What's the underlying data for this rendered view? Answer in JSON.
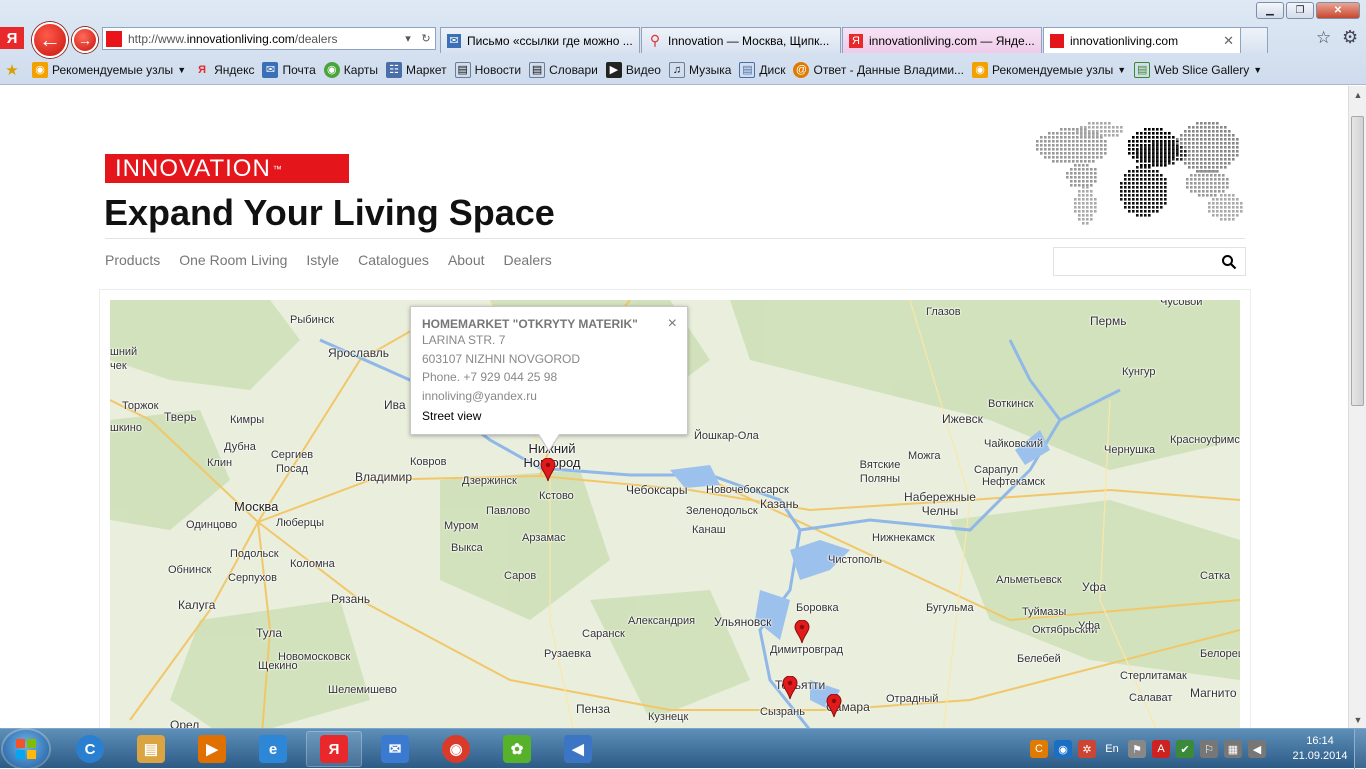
{
  "browser": {
    "window_controls": {
      "minimize": "▁",
      "maximize": "❐",
      "close": "✕"
    },
    "yandex_logo": "Я",
    "address": {
      "prefix": "http://www.",
      "host": "innovationliving.com",
      "path": "/dealers"
    },
    "tabs": [
      {
        "icon": "mail-icon",
        "label": "Письмо «ссылки где можно ...",
        "style": "normal"
      },
      {
        "icon": "map-pin-icon",
        "label": "Innovation — Москва, Щипк...",
        "style": "normal"
      },
      {
        "icon": "yandex-icon",
        "label": "innovationliving.com — Янде...",
        "style": "pink"
      },
      {
        "icon": "innovation-favicon",
        "label": "innovationliving.com",
        "style": "active"
      }
    ],
    "bookmarks": [
      {
        "icon": "folder-star-icon",
        "label": "Рекомендуемые узлы",
        "dropdown": true,
        "color": "#f2a100"
      },
      {
        "icon": "yandex-icon",
        "label": "Яндекс",
        "dropdown": false,
        "color": "#e8282b"
      },
      {
        "icon": "mail-icon",
        "label": "Почта",
        "dropdown": false,
        "color": "#3b6fb6"
      },
      {
        "icon": "maps-icon",
        "label": "Карты",
        "dropdown": false,
        "color": "#4aa43a"
      },
      {
        "icon": "market-icon",
        "label": "Маркет",
        "dropdown": false,
        "color": "#4a6fa8"
      },
      {
        "icon": "page-icon",
        "label": "Новости",
        "dropdown": false,
        "color": "#6c7d95"
      },
      {
        "icon": "dictionary-icon",
        "label": "Словари",
        "dropdown": false,
        "color": "#6c7d95"
      },
      {
        "icon": "video-icon",
        "label": "Видео",
        "dropdown": false,
        "color": "#222222"
      },
      {
        "icon": "music-icon",
        "label": "Музыка",
        "dropdown": false,
        "color": "#6c7d95"
      },
      {
        "icon": "disk-icon",
        "label": "Диск",
        "dropdown": false,
        "color": "#4a6fa8"
      },
      {
        "icon": "answers-icon",
        "label": "Ответ - Данные Владими...",
        "dropdown": false,
        "color": "#e07a00"
      },
      {
        "icon": "folder-star-icon",
        "label": "Рекомендуемые узлы",
        "dropdown": true,
        "color": "#f2a100"
      },
      {
        "icon": "web-slice-icon",
        "label": "Web Slice Gallery",
        "dropdown": true,
        "color": "#3b8a2e"
      }
    ]
  },
  "site": {
    "logo_text": "INNOVATION",
    "logo_tm": "™",
    "tagline": "Expand Your Living Space",
    "nav": [
      "Products",
      "One Room Living",
      "Istyle",
      "Catalogues",
      "About",
      "Dealers"
    ],
    "search_placeholder": ""
  },
  "map": {
    "popup": {
      "title": "HOMEMARKET \"OTKRYTY MATERIK\"",
      "street": "LARINA STR. 7",
      "city": "603107 NIZHNI NOVGOROD",
      "phone": "Phone. +7 929 044 25 98",
      "email": "innoliving@yandex.ru",
      "street_view": "Street view",
      "close": "×"
    },
    "cities": [
      {
        "name": "Рыбинск",
        "size": "small"
      },
      {
        "name": "Ярославль",
        "size": "mid"
      },
      {
        "name": "Глазов",
        "size": "small"
      },
      {
        "name": "Пермь",
        "size": "mid"
      },
      {
        "name": "Чусовой",
        "size": "small"
      },
      {
        "name": "Торжок",
        "size": "small"
      },
      {
        "name": "Тверь",
        "size": "mid"
      },
      {
        "name": "Кимры",
        "size": "small"
      },
      {
        "name": "Ива",
        "size": "mid"
      },
      {
        "name": "Дубна",
        "size": "small"
      },
      {
        "name": "Сергиев Посад",
        "size": "small"
      },
      {
        "name": "Клин",
        "size": "small"
      },
      {
        "name": "Ковров",
        "size": "small"
      },
      {
        "name": "Владимир",
        "size": "mid"
      },
      {
        "name": "Нижний Новгород",
        "size": "big"
      },
      {
        "name": "Дзержинск",
        "size": "small"
      },
      {
        "name": "Кстово",
        "size": "small"
      },
      {
        "name": "Йошкар-Ола",
        "size": "small"
      },
      {
        "name": "Чебоксары",
        "size": "mid"
      },
      {
        "name": "Новочебоксарск",
        "size": "small"
      },
      {
        "name": "Ижевск",
        "size": "mid"
      },
      {
        "name": "Воткинск",
        "size": "small"
      },
      {
        "name": "Чайковский",
        "size": "small"
      },
      {
        "name": "Кунгур",
        "size": "small"
      },
      {
        "name": "Чернушка",
        "size": "small"
      },
      {
        "name": "Красноуфимск",
        "size": "small"
      },
      {
        "name": "Можга",
        "size": "small"
      },
      {
        "name": "Вятские Поляны",
        "size": "small"
      },
      {
        "name": "Сарапул",
        "size": "small"
      },
      {
        "name": "Нефтекамск",
        "size": "small"
      },
      {
        "name": "Набережные Челны",
        "size": "mid"
      },
      {
        "name": "Москва",
        "size": "big"
      },
      {
        "name": "Люберцы",
        "size": "small"
      },
      {
        "name": "Одинцово",
        "size": "small"
      },
      {
        "name": "Подольск",
        "size": "small"
      },
      {
        "name": "Павлово",
        "size": "small"
      },
      {
        "name": "Зеленодольск",
        "size": "small"
      },
      {
        "name": "Казань",
        "size": "mid"
      },
      {
        "name": "Нижнекамск",
        "size": "small"
      },
      {
        "name": "Муром",
        "size": "small"
      },
      {
        "name": "Выкса",
        "size": "small"
      },
      {
        "name": "Арзамас",
        "size": "small"
      },
      {
        "name": "Канаш",
        "size": "small"
      },
      {
        "name": "Обнинск",
        "size": "small"
      },
      {
        "name": "Коломна",
        "size": "small"
      },
      {
        "name": "Чистополь",
        "size": "small"
      },
      {
        "name": "Серпухов",
        "size": "small"
      },
      {
        "name": "Саров",
        "size": "small"
      },
      {
        "name": "Альметьевск",
        "size": "small"
      },
      {
        "name": "Уфа",
        "size": "mid"
      },
      {
        "name": "Сатка",
        "size": "small"
      },
      {
        "name": "Калуга",
        "size": "mid"
      },
      {
        "name": "Рязань",
        "size": "mid"
      },
      {
        "name": "Бугульма",
        "size": "small"
      },
      {
        "name": "Туймазы",
        "size": "small"
      },
      {
        "name": "Боровка",
        "size": "small"
      },
      {
        "name": "Александрия",
        "size": "small"
      },
      {
        "name": "Ульяновск",
        "size": "mid"
      },
      {
        "name": "Октябрьский",
        "size": "small"
      },
      {
        "name": "Уфа",
        "size": "small"
      },
      {
        "name": "Тула",
        "size": "mid"
      },
      {
        "name": "Саранск",
        "size": "small"
      },
      {
        "name": "Димитровград",
        "size": "small"
      },
      {
        "name": "Белорецк",
        "size": "small"
      },
      {
        "name": "Новомосковск",
        "size": "small"
      },
      {
        "name": "Рузаевка",
        "size": "small"
      },
      {
        "name": "Белебей",
        "size": "small"
      },
      {
        "name": "Щекино",
        "size": "small"
      },
      {
        "name": "Стерлитамак",
        "size": "small"
      },
      {
        "name": "Шелемишево",
        "size": "small"
      },
      {
        "name": "Тольятти",
        "size": "mid"
      },
      {
        "name": "Отрадный",
        "size": "small"
      },
      {
        "name": "Салават",
        "size": "small"
      },
      {
        "name": "Магнито",
        "size": "mid"
      },
      {
        "name": "Пенза",
        "size": "mid"
      },
      {
        "name": "Сызрань",
        "size": "small"
      },
      {
        "name": "Самара",
        "size": "mid"
      },
      {
        "name": "Орел",
        "size": "mid"
      },
      {
        "name": "Кузнецк",
        "size": "small"
      },
      {
        "name": "шкино",
        "size": "small"
      },
      {
        "name": "шний",
        "size": "small"
      },
      {
        "name": "чек",
        "size": "small"
      }
    ]
  },
  "taskbar": {
    "apps": [
      {
        "icon": "cc-icon",
        "color": "#2a7fd0"
      },
      {
        "icon": "explorer-folder-icon",
        "color": "#d9a441"
      },
      {
        "icon": "media-player-icon",
        "color": "#e07000"
      },
      {
        "icon": "internet-explorer-icon",
        "color": "#2d86d6"
      },
      {
        "icon": "yandex-browser-icon",
        "color": "#e8282b"
      },
      {
        "icon": "mail-app-icon",
        "color": "#3a7ad0"
      },
      {
        "icon": "chrome-icon",
        "color": "#d93b2b"
      },
      {
        "icon": "icq-icon",
        "color": "#56b12b"
      },
      {
        "icon": "volume-app-icon",
        "color": "#3b75c4"
      }
    ],
    "tray": [
      "cc-icon",
      "shield-icon",
      "antivirus-icon",
      "En",
      "flag-icon",
      "pdf-icon",
      "security-icon",
      "action-center-icon",
      "network-icon",
      "volume-icon"
    ],
    "tray_lang": "En",
    "clock_time": "16:14",
    "clock_date": "21.09.2014"
  }
}
